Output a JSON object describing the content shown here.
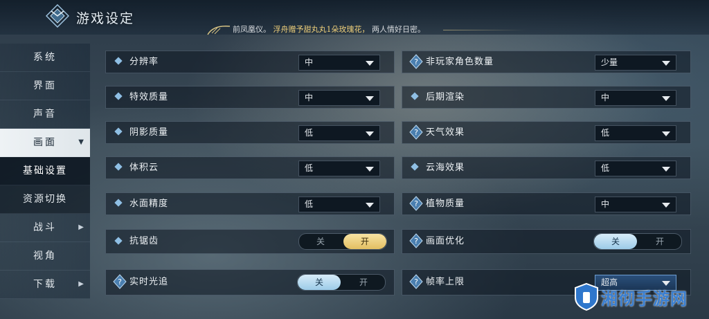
{
  "header": {
    "title": "游戏设定",
    "notice": {
      "part_a": "前凤凰仪。",
      "part_b": "浮舟赠予甜丸丸1朵玫瑰花，",
      "part_c": "两人情好日密。"
    }
  },
  "sidebar": {
    "items": [
      {
        "label": "系统"
      },
      {
        "label": "界面"
      },
      {
        "label": "声音"
      },
      {
        "label": "画面"
      },
      {
        "label": "基础设置"
      },
      {
        "label": "资源切换"
      },
      {
        "label": "战斗"
      },
      {
        "label": "视角"
      },
      {
        "label": "下载"
      }
    ]
  },
  "settings": {
    "left": [
      {
        "label": "分辨率",
        "value": "中"
      },
      {
        "label": "特效质量",
        "value": "中"
      },
      {
        "label": "阴影质量",
        "value": "低"
      },
      {
        "label": "体积云",
        "value": "低"
      },
      {
        "label": "水面精度",
        "value": "低"
      },
      {
        "label": "抗锯齿",
        "off": "关",
        "on": "开",
        "state": "开"
      },
      {
        "label": "实时光追",
        "off": "关",
        "on": "开",
        "state": "关"
      }
    ],
    "right": [
      {
        "label": "非玩家角色数量",
        "value": "少量"
      },
      {
        "label": "后期渲染",
        "value": "中"
      },
      {
        "label": "天气效果",
        "value": "低"
      },
      {
        "label": "云海效果",
        "value": "低"
      },
      {
        "label": "植物质量",
        "value": "中"
      },
      {
        "label": "画面优化",
        "off": "关",
        "on": "开",
        "state": "关"
      },
      {
        "label": "帧率上限",
        "value": "超高"
      }
    ]
  },
  "watermark": {
    "text": "湘彻手游网"
  },
  "colors": {
    "accent_gold": "#e3bf62",
    "accent_blue": "#9ccbe8",
    "diamond": "#8fbfe4"
  }
}
